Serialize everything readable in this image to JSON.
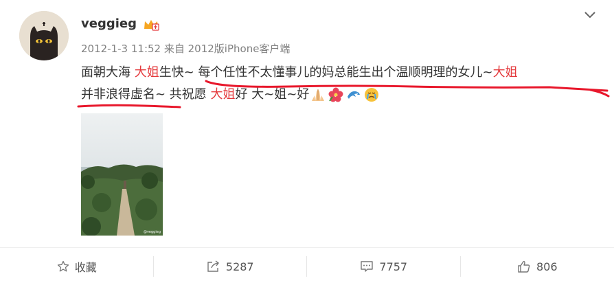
{
  "post": {
    "username": "veggieg",
    "meta": "2012-1-3 11:52 来自 2012版iPhone客户端",
    "content": {
      "seg1": "面朝大海 ",
      "hl1": "大姐",
      "seg2": "生快~ 每个任性不太懂事儿的妈总能生出个温顺明理的女儿~",
      "hl2": "大姐",
      "seg3": "并非浪得虚名~ 共祝愿 ",
      "hl3": "大姐",
      "seg4": "好 大~姐~好"
    },
    "emoji_icons": [
      "pray-icon",
      "hibiscus-icon",
      "dolphin-icon",
      "sob-face-icon"
    ],
    "photo_watermark": "@veggieg"
  },
  "actions": {
    "favorite_label": "收藏",
    "repost_count": "5287",
    "comment_count": "7757",
    "like_count": "806"
  },
  "colors": {
    "highlight": "#e4393c",
    "underline": "#e8172b",
    "text": "#333333",
    "meta": "#808080"
  }
}
